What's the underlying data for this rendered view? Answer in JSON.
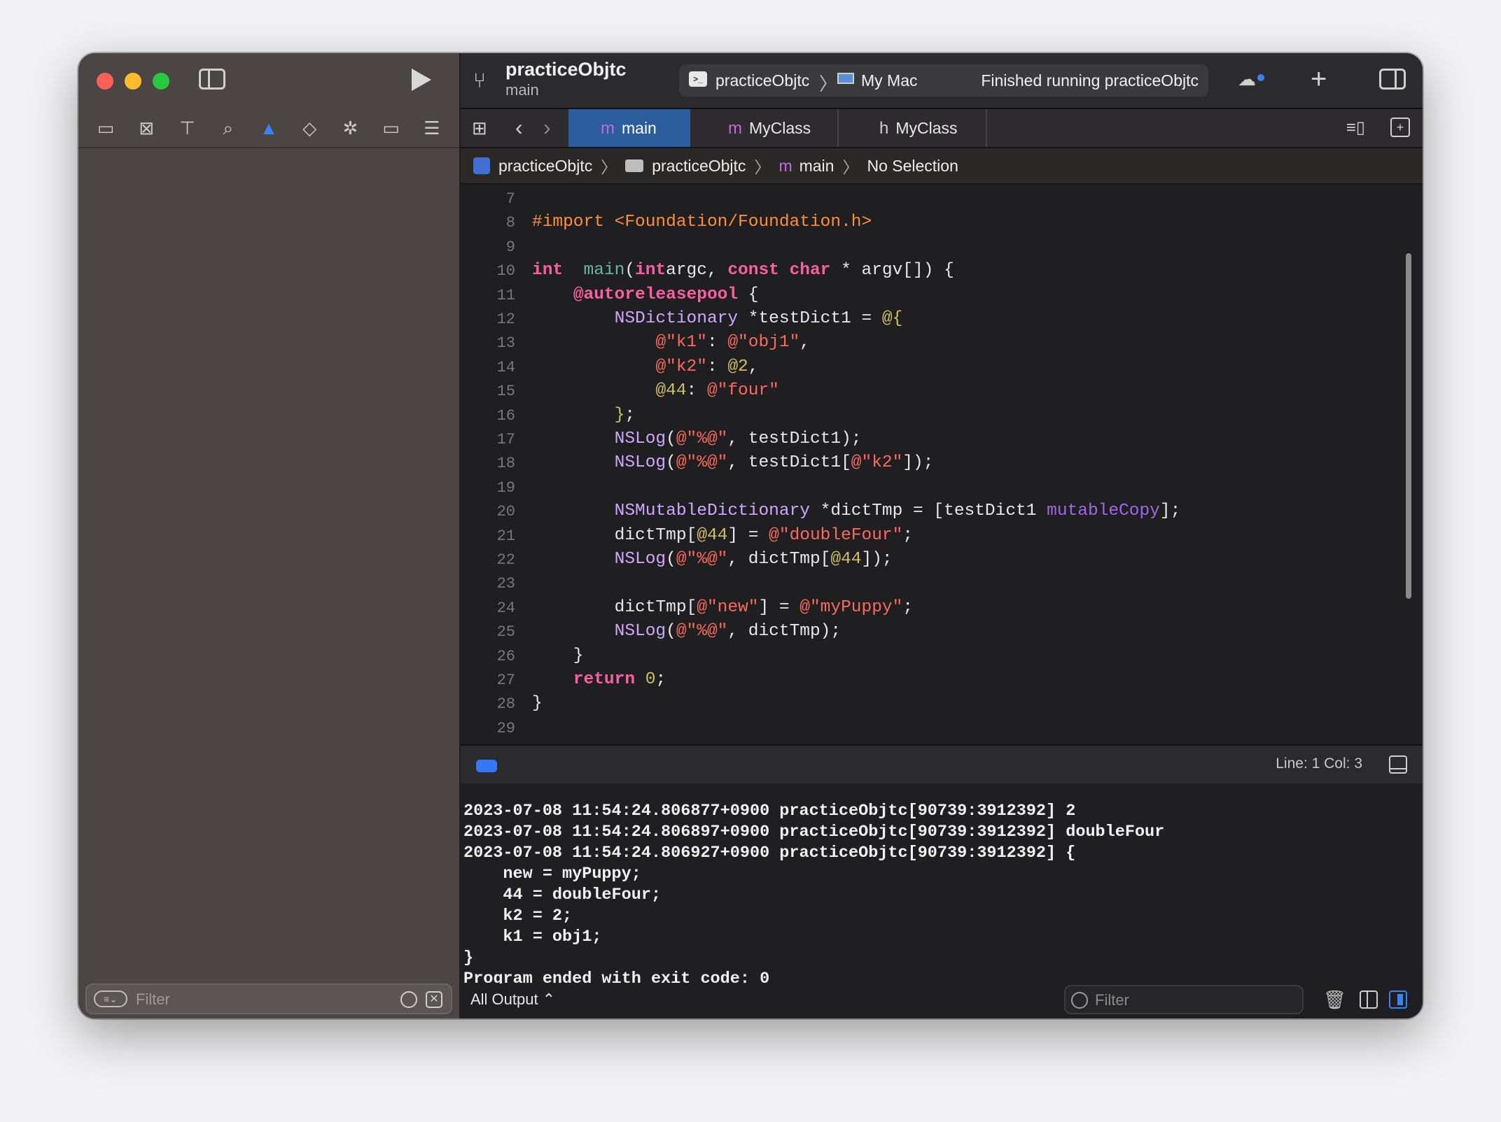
{
  "toolbar": {
    "project_title": "practiceObjtc",
    "branch": "main",
    "scheme": "practiceObjtc",
    "destination": "My Mac",
    "status": "Finished running practiceObjtc"
  },
  "navigator": {
    "icons": [
      "folder-icon",
      "source-control-icon",
      "symbol-icon",
      "search-icon",
      "warning-icon",
      "test-icon",
      "debug-icon",
      "breakpoint-icon",
      "report-icon"
    ],
    "filter_placeholder": "Filter"
  },
  "tabs": [
    {
      "glyph": "m",
      "label": "main",
      "active": true
    },
    {
      "glyph": "m",
      "label": "MyClass",
      "active": false
    },
    {
      "glyph": "h",
      "label": "MyClass",
      "active": false
    }
  ],
  "breadcrumb": {
    "project": "practiceObjtc",
    "folder": "practiceObjtc",
    "file_glyph": "m",
    "file": "main",
    "selection": "No Selection",
    "separator": "〉"
  },
  "editor": {
    "line_numbers": [
      "7",
      "8",
      "9",
      "10",
      "11",
      "12",
      "13",
      "14",
      "15",
      "16",
      "17",
      "18",
      "19",
      "20",
      "21",
      "22",
      "23",
      "24",
      "25",
      "26",
      "27",
      "28",
      "29"
    ],
    "lines": [
      [],
      [
        [
          "pp",
          "#import <Foundation/Foundation.h>"
        ]
      ],
      [],
      [
        [
          "kw",
          "int"
        ],
        [
          "",
          "  "
        ],
        [
          "fn",
          "main"
        ],
        [
          "",
          "("
        ],
        [
          "kw",
          "int"
        ],
        [
          "",
          ""
        ],
        [
          "",
          "argc, "
        ],
        [
          "kw",
          "const"
        ],
        [
          "",
          " "
        ],
        [
          "kw",
          "char"
        ],
        [
          "",
          " * argv[]) {"
        ]
      ],
      [
        [
          "",
          "    "
        ],
        [
          "kw",
          "@autoreleasepool"
        ],
        [
          "",
          " {"
        ]
      ],
      [
        [
          "",
          "        "
        ],
        [
          "cls",
          "NSDictionary"
        ],
        [
          "",
          " *testDict1 = "
        ],
        [
          "num",
          "@{"
        ]
      ],
      [
        [
          "",
          "            "
        ],
        [
          "str",
          "@\"k1\""
        ],
        [
          "",
          ": "
        ],
        [
          "str",
          "@\"obj1\""
        ],
        [
          "",
          ","
        ]
      ],
      [
        [
          "",
          "            "
        ],
        [
          "str",
          "@\"k2\""
        ],
        [
          "",
          ": "
        ],
        [
          "num",
          "@2"
        ],
        [
          "",
          ","
        ]
      ],
      [
        [
          "",
          "            "
        ],
        [
          "num",
          "@44"
        ],
        [
          "",
          ": "
        ],
        [
          "str",
          "@\"four\""
        ]
      ],
      [
        [
          "",
          "        "
        ],
        [
          "num",
          "}"
        ],
        [
          "",
          ";"
        ]
      ],
      [
        [
          "",
          "        "
        ],
        [
          "cls",
          "NSLog"
        ],
        [
          "",
          "("
        ],
        [
          "str",
          "@\"%@\""
        ],
        [
          "",
          ", testDict1);"
        ]
      ],
      [
        [
          "",
          "        "
        ],
        [
          "cls",
          "NSLog"
        ],
        [
          "",
          "("
        ],
        [
          "str",
          "@\"%@\""
        ],
        [
          "",
          ", testDict1["
        ],
        [
          "str",
          "@\"k2\""
        ],
        [
          "",
          "]);"
        ]
      ],
      [],
      [
        [
          "",
          "        "
        ],
        [
          "cls",
          "NSMutableDictionary"
        ],
        [
          "",
          " *dictTmp = [testDict1 "
        ],
        [
          "mc",
          "mutableCopy"
        ],
        [
          "",
          "];"
        ]
      ],
      [
        [
          "",
          "        dictTmp["
        ],
        [
          "num",
          "@44"
        ],
        [
          "",
          "] = "
        ],
        [
          "str",
          "@\"doubleFour\""
        ],
        [
          "",
          ";"
        ]
      ],
      [
        [
          "",
          "        "
        ],
        [
          "cls",
          "NSLog"
        ],
        [
          "",
          "("
        ],
        [
          "str",
          "@\"%@\""
        ],
        [
          "",
          ", dictTmp["
        ],
        [
          "num",
          "@44"
        ],
        [
          "",
          "]);"
        ]
      ],
      [],
      [
        [
          "",
          "        dictTmp["
        ],
        [
          "str",
          "@\"new\""
        ],
        [
          "",
          "] = "
        ],
        [
          "str",
          "@\"myPuppy\""
        ],
        [
          "",
          ";"
        ]
      ],
      [
        [
          "",
          "        "
        ],
        [
          "cls",
          "NSLog"
        ],
        [
          "",
          "("
        ],
        [
          "str",
          "@\"%@\""
        ],
        [
          "",
          ", dictTmp);"
        ]
      ],
      [
        [
          "",
          "    }"
        ]
      ],
      [
        [
          "",
          "    "
        ],
        [
          "kw",
          "return"
        ],
        [
          "",
          " "
        ],
        [
          "num",
          "0"
        ],
        [
          "",
          ";"
        ]
      ],
      [
        [
          "",
          "}"
        ]
      ],
      []
    ]
  },
  "debug_bar": {
    "line_col": "Line: 1  Col: 3"
  },
  "console": {
    "lines": [
      "2023-07-08 11:54:24.806877+0900 practiceObjtc[90739:3912392] 2",
      "2023-07-08 11:54:24.806897+0900 practiceObjtc[90739:3912392] doubleFour",
      "2023-07-08 11:54:24.806927+0900 practiceObjtc[90739:3912392] {",
      "    new = myPuppy;",
      "    44 = doubleFour;",
      "    k2 = 2;",
      "    k1 = obj1;",
      "}",
      "Program ended with exit code: 0"
    ],
    "output_selector": "All Output ⌃",
    "filter_placeholder": "Filter"
  },
  "colors": {
    "accent": "#3b82f6",
    "keyword": "#fc5fa3",
    "string": "#fc6a5d",
    "number": "#d0bf69",
    "class": "#d0a8ff",
    "preprocessor": "#fd8f3f"
  }
}
